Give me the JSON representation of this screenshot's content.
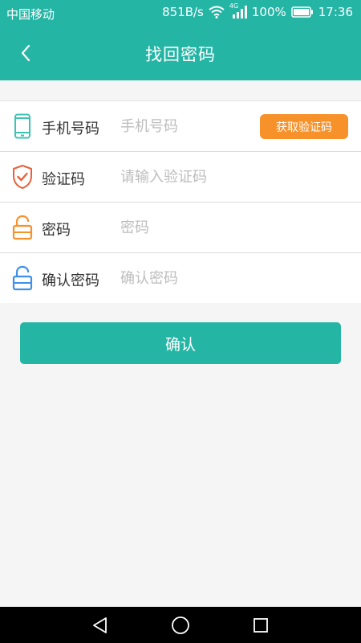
{
  "status_bar": {
    "carrier": "中国移动",
    "speed": "851B/s",
    "network_type": "4G",
    "battery": "100%",
    "time": "17:36"
  },
  "header": {
    "title": "找回密码",
    "back_icon": "chevron-left-icon"
  },
  "form": {
    "phone": {
      "label": "手机号码",
      "placeholder": "手机号码",
      "icon": "phone-icon"
    },
    "get_code_label": "获取验证码",
    "code": {
      "label": "验证码",
      "placeholder": "请输入验证码",
      "icon": "shield-check-icon"
    },
    "password": {
      "label": "密码",
      "placeholder": "密码",
      "icon": "unlock-icon"
    },
    "confirm_password": {
      "label": "确认密码",
      "placeholder": "确认密码",
      "icon": "unlock-icon"
    }
  },
  "confirm_label": "确认",
  "colors": {
    "primary": "#25b5a5",
    "accent_orange": "#f7922b",
    "phone_icon": "#3cc3b4",
    "shield_icon": "#e9603b",
    "lock_icon_orange": "#f7922b",
    "lock_icon_blue": "#3f8fe8"
  },
  "nav_bar": {
    "back_icon": "triangle-back-icon",
    "home_icon": "circle-home-icon",
    "recents_icon": "square-recents-icon"
  }
}
